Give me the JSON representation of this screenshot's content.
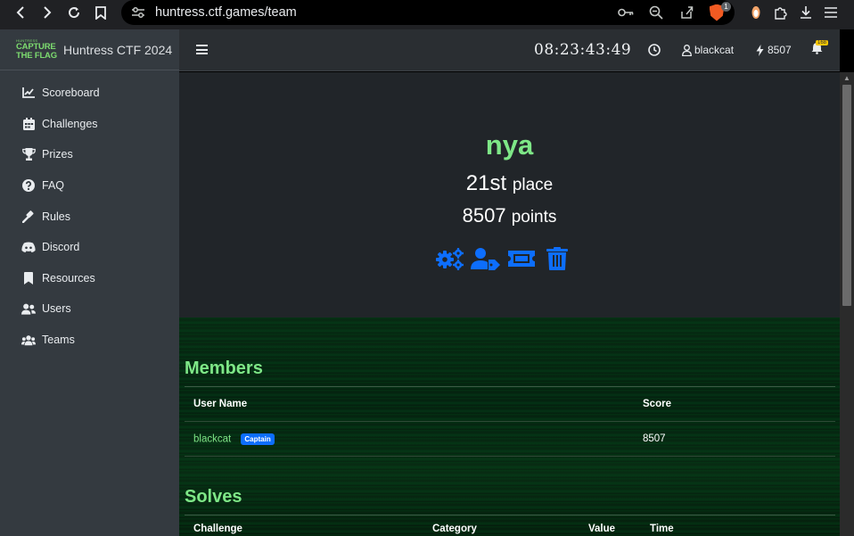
{
  "browser": {
    "url": "huntress.ctf.games/team",
    "extension_badge": "1"
  },
  "sidebar": {
    "logo": {
      "line0": "HUNTRESS",
      "line1": "CAPTURE",
      "line2": "THE FLAG"
    },
    "title": "Huntress CTF 2024",
    "items": [
      {
        "label": "Scoreboard",
        "icon": "chart-line-icon"
      },
      {
        "label": "Challenges",
        "icon": "calendar-icon"
      },
      {
        "label": "Prizes",
        "icon": "trophy-icon"
      },
      {
        "label": "FAQ",
        "icon": "question-circle-icon"
      },
      {
        "label": "Rules",
        "icon": "gavel-icon"
      },
      {
        "label": "Discord",
        "icon": "discord-icon"
      },
      {
        "label": "Resources",
        "icon": "bookmark-icon"
      },
      {
        "label": "Users",
        "icon": "user-group-icon"
      },
      {
        "label": "Teams",
        "icon": "users-icon"
      }
    ]
  },
  "topbar": {
    "timer": "08:23:43:49",
    "username": "blackcat",
    "points": "8507",
    "notification_badge": "168"
  },
  "team": {
    "name": "nya",
    "place_number": "21st",
    "place_word": "place",
    "points_number": "8507",
    "points_word": "points"
  },
  "members": {
    "heading": "Members",
    "columns": [
      "User Name",
      "Score"
    ],
    "rows": [
      {
        "user": "blackcat",
        "badge": "Captain",
        "score": "8507"
      }
    ]
  },
  "solves": {
    "heading": "Solves",
    "columns": [
      "Challenge",
      "Category",
      "Value",
      "Time"
    ]
  },
  "colors": {
    "accent_green": "#7ee787",
    "accent_blue": "#0d6efd",
    "sidebar_bg": "#343a40",
    "main_bg": "#212529"
  }
}
